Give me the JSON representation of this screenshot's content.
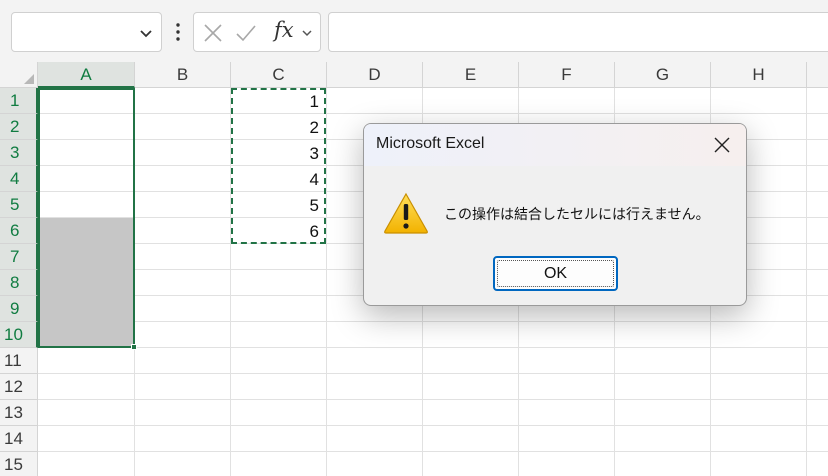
{
  "formula_bar": {
    "name_box_value": "",
    "cancel_icon": "close-x-icon",
    "enter_icon": "checkmark-icon",
    "fx_label": "fx",
    "formula_value": ""
  },
  "grid": {
    "columns": [
      "A",
      "B",
      "C",
      "D",
      "E",
      "F",
      "G",
      "H"
    ],
    "rows": [
      "1",
      "2",
      "3",
      "4",
      "5",
      "6",
      "7",
      "8",
      "9",
      "10",
      "11",
      "12",
      "13",
      "14",
      "15"
    ],
    "selected_column": "A",
    "selected_rows": "1-10",
    "column_c_values": [
      "1",
      "2",
      "3",
      "4",
      "5",
      "6"
    ],
    "selection_color": "#217346",
    "gray_fill_color": "#c6c6c6"
  },
  "dialog": {
    "title": "Microsoft Excel",
    "message": "この操作は結合したセルには行えません。",
    "ok_label": "OK",
    "icon": "warning-icon",
    "accent_color": "#0067c0"
  }
}
